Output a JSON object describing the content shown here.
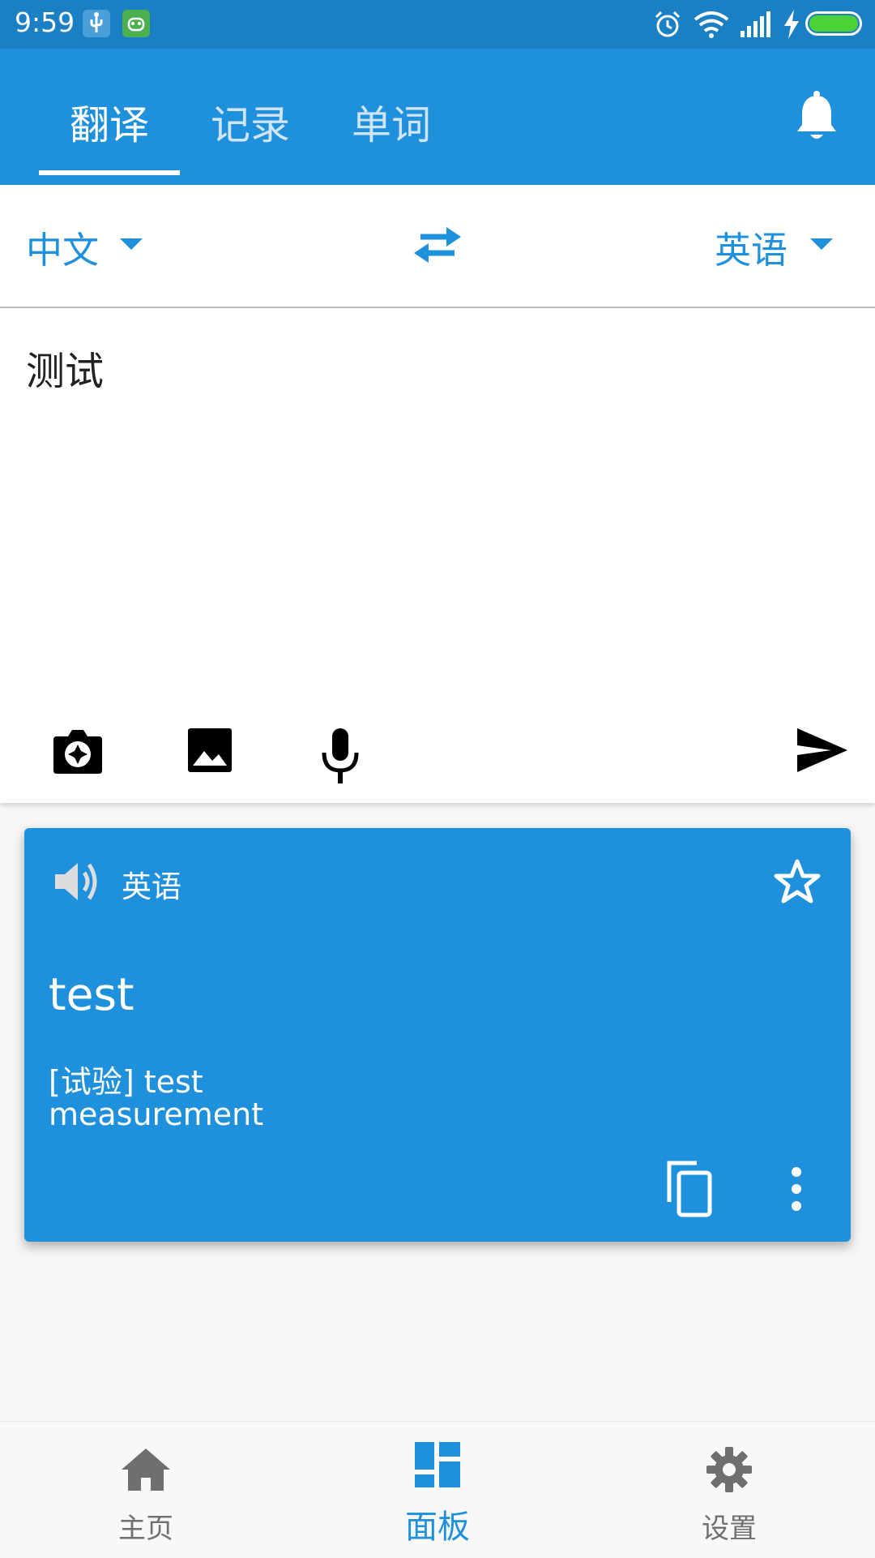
{
  "status_bar": {
    "time": "9:59"
  },
  "tabs": [
    {
      "label": "翻译",
      "active": true
    },
    {
      "label": "记录",
      "active": false
    },
    {
      "label": "单词",
      "active": false
    }
  ],
  "language": {
    "source": "中文",
    "target": "英语"
  },
  "input": {
    "text": "测试"
  },
  "result": {
    "language": "英语",
    "main_translation": "test",
    "alternatives": [
      "[试验] test",
      "measurement"
    ]
  },
  "bottom_nav": [
    {
      "label": "主页",
      "icon": "home-icon",
      "active": false
    },
    {
      "label": "面板",
      "icon": "dashboard-icon",
      "active": true
    },
    {
      "label": "设置",
      "icon": "settings-icon",
      "active": false
    }
  ],
  "colors": {
    "primary": "#1f90db",
    "status_bar": "#1b7fc4",
    "inactive": "#6f6f6f"
  }
}
